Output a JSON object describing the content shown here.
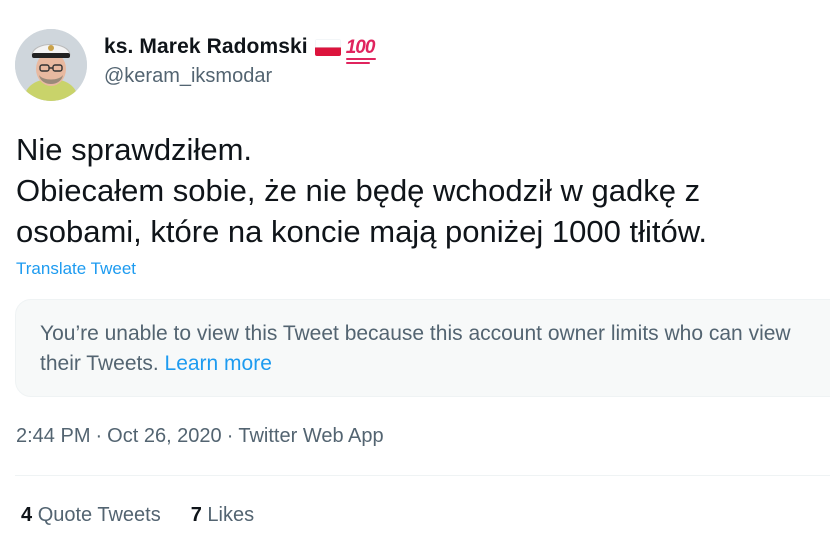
{
  "author": {
    "display_name": "ks. Marek Radomski",
    "handle": "@keram_iksmodar",
    "emoji_1": "polish-flag-icon",
    "emoji_2": "hundred-points-icon"
  },
  "tweet": {
    "lines": [
      "Nie sprawdziłem.",
      "Obiecałem sobie, że nie będę wchodził w gadkę z",
      "osobami, które na koncie mają poniżej 1000 tłitów."
    ],
    "translate_label": "Translate Tweet"
  },
  "unavailable_card": {
    "message": "You’re unable to view this Tweet because this account owner limits who can view their Tweets.",
    "learn_more": "Learn more"
  },
  "meta": {
    "time": "2:44 PM",
    "date": "Oct 26, 2020",
    "source": "Twitter Web App",
    "separator": "·"
  },
  "stats": {
    "quote_tweets_count": "4",
    "quote_tweets_label": "Quote Tweets",
    "likes_count": "7",
    "likes_label": "Likes"
  },
  "colors": {
    "link": "#1d9bf0",
    "text_primary": "#0f1419",
    "text_secondary": "#536471",
    "card_background": "#f7f9f9",
    "emoji_red": "#e0245e"
  }
}
